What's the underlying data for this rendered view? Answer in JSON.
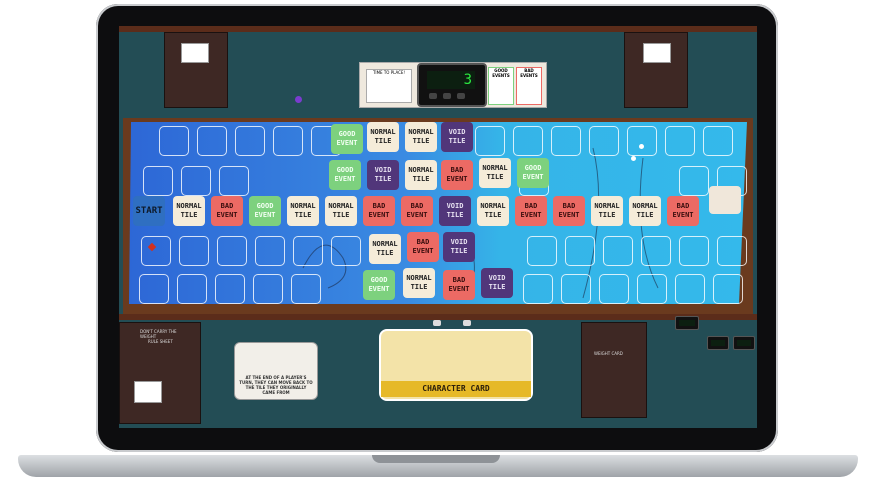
{
  "timer": {
    "value": "3"
  },
  "top_tray": {
    "good_label": "GOOD EVENTS",
    "bad_label": "BAD EVENTS",
    "placing_label": "TIME TO PLACE!"
  },
  "board": {
    "start_label": "START",
    "tile_labels": {
      "normal": "NORMAL TILE",
      "void": "VOID TILE",
      "bad": "BAD EVENT",
      "good": "GOOD EVENT"
    }
  },
  "cards": {
    "character_label": "CHARACTER CARD",
    "event_text": "AT THE END OF A PLAYER'S TURN, THEY CAN MOVE BACK TO THE TILE THEY ORIGINALLY CAME FROM",
    "rules_title": "DON'T CARRY THE WEIGHT",
    "rules_subtitle": "RULE SHEET",
    "right_sheet_title": "WEIGHT CARD"
  },
  "colors": {
    "board_blue": "#2f7fdc",
    "board_cyan": "#33b5e8",
    "table": "#234d55",
    "normal": "#f5ecd9",
    "void": "#51367a",
    "bad": "#ec6a64",
    "good": "#7dd17e"
  }
}
